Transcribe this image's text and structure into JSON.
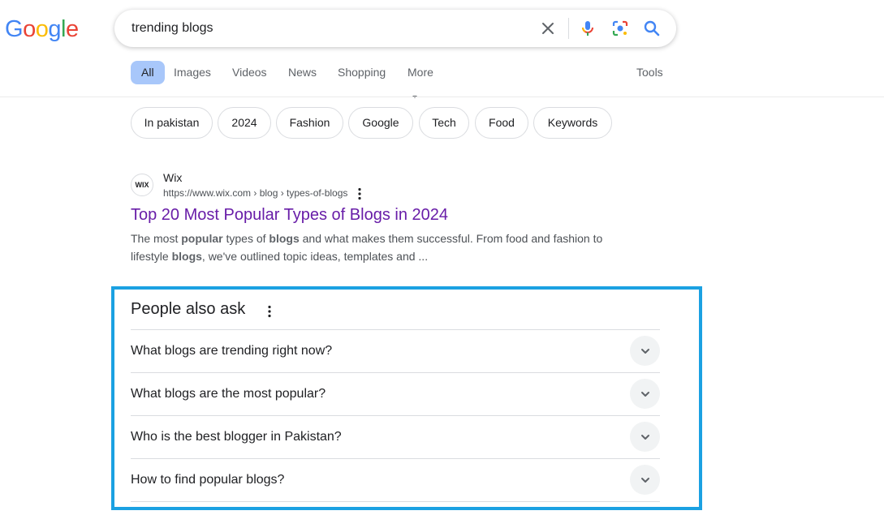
{
  "logo": {
    "letters": [
      {
        "ch": "G",
        "color": "#4285F4"
      },
      {
        "ch": "o",
        "color": "#EA4335"
      },
      {
        "ch": "o",
        "color": "#FBBC05"
      },
      {
        "ch": "g",
        "color": "#4285F4"
      },
      {
        "ch": "l",
        "color": "#34A853"
      },
      {
        "ch": "e",
        "color": "#EA4335"
      }
    ]
  },
  "search": {
    "query": "trending blogs",
    "clear_icon": "close-icon",
    "voice_icon": "mic-icon",
    "lens_icon": "lens-icon",
    "search_icon": "search-icon"
  },
  "tabs": [
    {
      "label": "All",
      "active": true
    },
    {
      "label": "Images"
    },
    {
      "label": "Videos"
    },
    {
      "label": "News"
    },
    {
      "label": "Shopping"
    },
    {
      "label": "More"
    }
  ],
  "tools_label": "Tools",
  "chips": [
    "In pakistan",
    "2024",
    "Fashion",
    "Google",
    "Tech",
    "Food",
    "Keywords"
  ],
  "result": {
    "favicon_text": "WIX",
    "site": "Wix",
    "url": "https://www.wix.com › blog › types-of-blogs",
    "title": "Top 20 Most Popular Types of Blogs in 2024",
    "snippet": {
      "s1": "The most ",
      "b1": "popular",
      "s2": " types of ",
      "b2": "blogs",
      "s3": " and what makes them successful. From food and fashion to lifestyle ",
      "b3": "blogs",
      "s4": ", we've outlined topic ideas, templates and ..."
    }
  },
  "paa": {
    "title": "People also ask",
    "questions": [
      "What blogs are trending right now?",
      "What blogs are the most popular?",
      "Who is the best blogger in Pakistan?",
      "How to find popular blogs?"
    ]
  },
  "colors": {
    "accent_tab": "#a8c7fa",
    "link_visited": "#681da8",
    "highlight_frame": "#1ba1e2"
  }
}
